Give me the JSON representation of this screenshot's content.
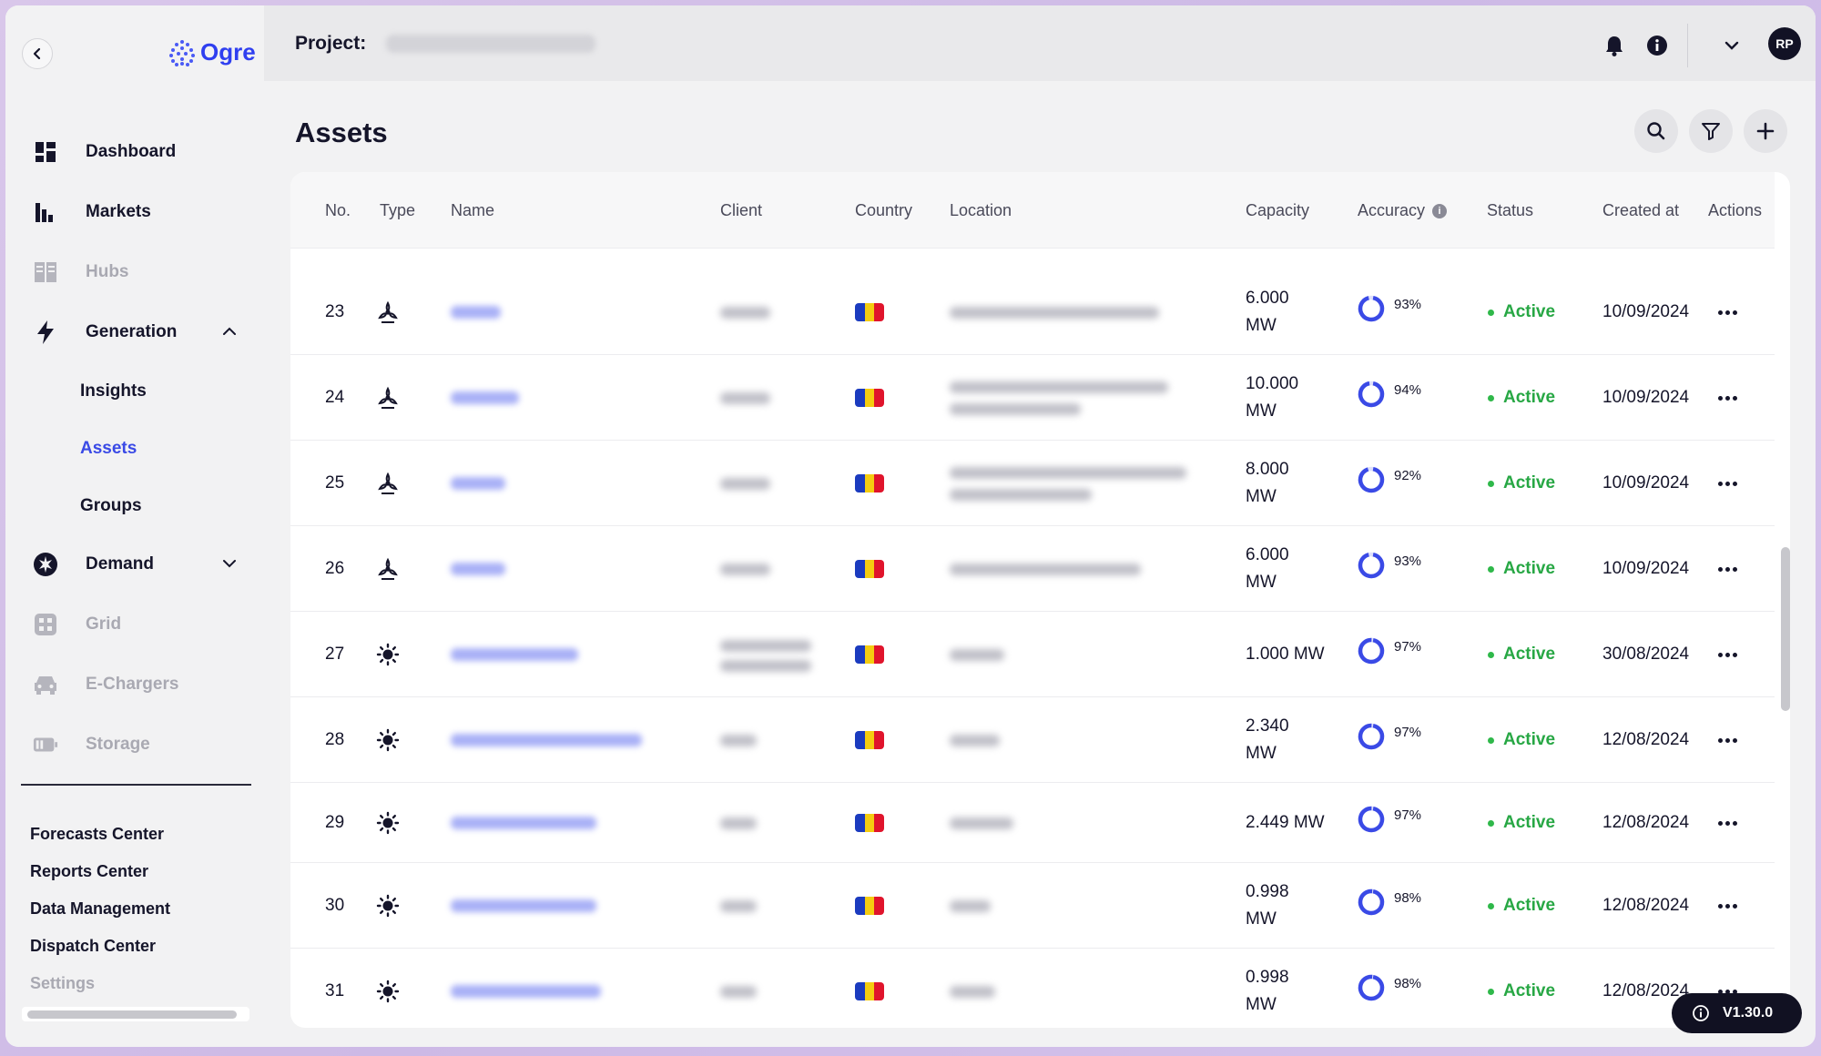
{
  "app": {
    "brand": "Ogre"
  },
  "topbar": {
    "project_label": "Project:",
    "avatar_initials": "RP"
  },
  "sidebar": {
    "items": [
      {
        "label": "Dashboard",
        "icon": "dashboard-icon",
        "state": "normal"
      },
      {
        "label": "Markets",
        "icon": "bar-chart-icon",
        "state": "normal"
      },
      {
        "label": "Hubs",
        "icon": "hubs-icon",
        "state": "disabled"
      },
      {
        "label": "Generation",
        "icon": "lightning-icon",
        "state": "expanded"
      },
      {
        "label": "Demand",
        "icon": "demand-icon",
        "state": "collapsed"
      },
      {
        "label": "Grid",
        "icon": "grid-icon",
        "state": "disabled"
      },
      {
        "label": "E-Chargers",
        "icon": "car-icon",
        "state": "disabled"
      },
      {
        "label": "Storage",
        "icon": "battery-icon",
        "state": "disabled"
      }
    ],
    "generation_sub": [
      {
        "label": "Insights",
        "active": false
      },
      {
        "label": "Assets",
        "active": true
      },
      {
        "label": "Groups",
        "active": false
      }
    ],
    "bottom_links": [
      "Forecasts Center",
      "Reports Center",
      "Data Management",
      "Dispatch Center",
      "Settings"
    ]
  },
  "main": {
    "title": "Assets",
    "columns": [
      "No.",
      "Type",
      "Name",
      "Client",
      "Country",
      "Location",
      "Capacity",
      "Accuracy",
      "Status",
      "Created at",
      "Actions"
    ],
    "rows": [
      {
        "no": "23",
        "type": "wind",
        "cap1": "6.000",
        "cap2": "MW",
        "acc": "93%",
        "acc_value": 0.93,
        "status": "Active",
        "created": "10/09/2024"
      },
      {
        "no": "24",
        "type": "wind",
        "cap1": "10.000",
        "cap2": "MW",
        "acc": "94%",
        "acc_value": 0.94,
        "status": "Active",
        "created": "10/09/2024"
      },
      {
        "no": "25",
        "type": "wind",
        "cap1": "8.000",
        "cap2": "MW",
        "acc": "92%",
        "acc_value": 0.92,
        "status": "Active",
        "created": "10/09/2024"
      },
      {
        "no": "26",
        "type": "wind",
        "cap1": "6.000",
        "cap2": "MW",
        "acc": "93%",
        "acc_value": 0.93,
        "status": "Active",
        "created": "10/09/2024"
      },
      {
        "no": "27",
        "type": "solar",
        "cap1": "1.000 MW",
        "cap2": "",
        "acc": "97%",
        "acc_value": 0.97,
        "status": "Active",
        "created": "30/08/2024"
      },
      {
        "no": "28",
        "type": "solar",
        "cap1": "2.340",
        "cap2": "MW",
        "acc": "97%",
        "acc_value": 0.97,
        "status": "Active",
        "created": "12/08/2024"
      },
      {
        "no": "29",
        "type": "solar",
        "cap1": "2.449 MW",
        "cap2": "",
        "acc": "97%",
        "acc_value": 0.97,
        "status": "Active",
        "created": "12/08/2024"
      },
      {
        "no": "30",
        "type": "solar",
        "cap1": "0.998",
        "cap2": "MW",
        "acc": "98%",
        "acc_value": 0.98,
        "status": "Active",
        "created": "12/08/2024"
      },
      {
        "no": "31",
        "type": "solar",
        "cap1": "0.998",
        "cap2": "MW",
        "acc": "98%",
        "acc_value": 0.98,
        "status": "Active",
        "created": "12/08/2024"
      }
    ]
  },
  "version": "V1.30.0",
  "colors": {
    "accent": "#3a4ae6",
    "active_green": "#27a744",
    "flag_blue": "#1b3bbf",
    "flag_yellow": "#f5cc10",
    "flag_red": "#e0142c"
  }
}
